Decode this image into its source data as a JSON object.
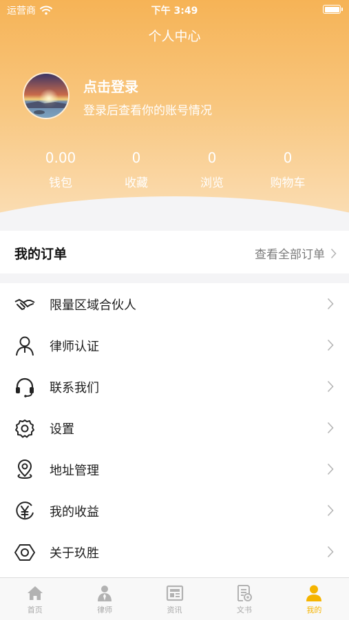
{
  "status_bar": {
    "carrier": "运营商",
    "time": "下午 3:49"
  },
  "header": {
    "title": "个人中心",
    "login_title": "点击登录",
    "login_subtitle": "登录后查看你的账号情况"
  },
  "stats": [
    {
      "value": "0.00",
      "label": "钱包"
    },
    {
      "value": "0",
      "label": "收藏"
    },
    {
      "value": "0",
      "label": "浏览"
    },
    {
      "value": "0",
      "label": "购物车"
    }
  ],
  "orders": {
    "title": "我的订单",
    "view_all": "查看全部订单"
  },
  "menu": [
    {
      "label": "限量区域合伙人",
      "icon": "handshake-icon"
    },
    {
      "label": "律师认证",
      "icon": "person-icon"
    },
    {
      "label": "联系我们",
      "icon": "headset-icon"
    },
    {
      "label": "设置",
      "icon": "gear-icon"
    },
    {
      "label": "地址管理",
      "icon": "location-pin-icon"
    },
    {
      "label": "我的收益",
      "icon": "yen-icon"
    },
    {
      "label": "关于玖胜",
      "icon": "hexagon-icon"
    }
  ],
  "tabbar": [
    {
      "label": "首页",
      "icon": "home-icon",
      "active": false
    },
    {
      "label": "律师",
      "icon": "lawyer-icon",
      "active": false
    },
    {
      "label": "资讯",
      "icon": "news-icon",
      "active": false
    },
    {
      "label": "文书",
      "icon": "document-icon",
      "active": false
    },
    {
      "label": "我的",
      "icon": "profile-icon",
      "active": true
    }
  ],
  "colors": {
    "accent": "#f5b400",
    "header_top": "#f6b356",
    "header_bottom": "#fbe0ba",
    "inactive": "#a9a9a9"
  }
}
